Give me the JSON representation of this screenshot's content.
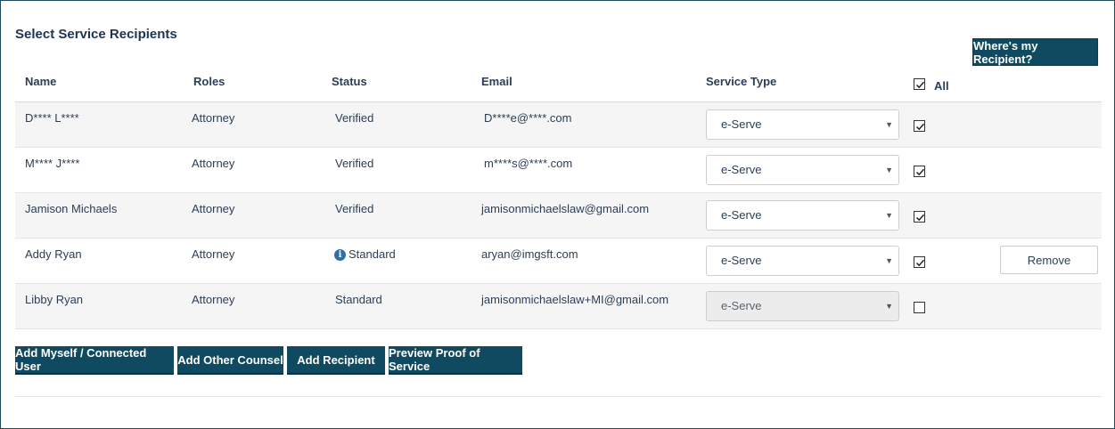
{
  "title": "Select Service Recipients",
  "where_button": "Where's my Recipient?",
  "columns": {
    "name": "Name",
    "roles": "Roles",
    "status": "Status",
    "email": "Email",
    "service_type": "Service Type",
    "all": "All"
  },
  "select_all_checked": true,
  "rows": [
    {
      "name": "D**** L****",
      "role": "Attorney",
      "status": "Verified",
      "status_icon": "",
      "email": "D****e@****.com",
      "service_type": "e-Serve",
      "select_disabled": false,
      "checked": true,
      "remove": ""
    },
    {
      "name": "M**** J****",
      "role": "Attorney",
      "status": "Verified",
      "status_icon": "",
      "email": "m****s@****.com",
      "service_type": "e-Serve",
      "select_disabled": false,
      "checked": true,
      "remove": ""
    },
    {
      "name": "Jamison Michaels",
      "role": "Attorney",
      "status": "Verified",
      "status_icon": "",
      "email": "jamisonmichaelslaw@gmail.com",
      "service_type": "e-Serve",
      "select_disabled": false,
      "checked": true,
      "remove": ""
    },
    {
      "name": "Addy Ryan",
      "role": "Attorney",
      "status": "Standard",
      "status_icon": "info-icon",
      "email": "aryan@imgsft.com",
      "service_type": "e-Serve",
      "select_disabled": false,
      "checked": true,
      "remove": "Remove"
    },
    {
      "name": "Libby Ryan",
      "role": "Attorney",
      "status": "Standard",
      "status_icon": "",
      "email": "jamisonmichaelslaw+MI@gmail.com",
      "service_type": "e-Serve",
      "select_disabled": true,
      "checked": false,
      "remove": ""
    }
  ],
  "actions": {
    "add_myself": "Add Myself / Connected User",
    "add_other_counsel": "Add Other Counsel",
    "add_recipient": "Add Recipient",
    "preview_proof": "Preview Proof of Service"
  },
  "colors": {
    "primary_button": "#0f4a60",
    "text": "#2c3e55",
    "info_icon": "#2f6fa8"
  }
}
